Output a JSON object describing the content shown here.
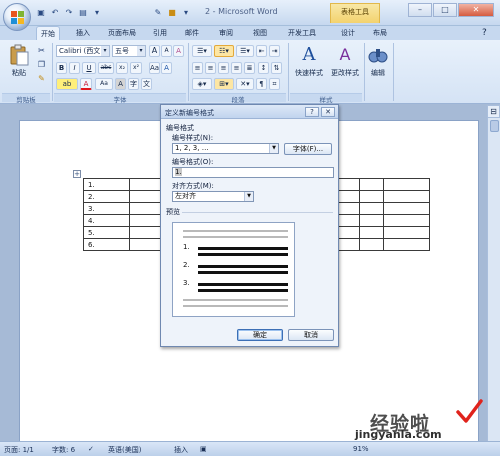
{
  "window": {
    "title": "2 - Microsoft Word",
    "contextual_tab_group": "表格工具",
    "controls": {
      "minimize": "–",
      "maximize": "□",
      "close": "✕"
    }
  },
  "quick_access": [
    "save-icon",
    "undo-icon",
    "redo-icon",
    "print-preview-icon"
  ],
  "tabs": [
    "开始",
    "插入",
    "页面布局",
    "引用",
    "邮件",
    "审阅",
    "视图",
    "开发工具",
    "设计",
    "布局"
  ],
  "active_tab": "开始",
  "ribbon": {
    "clipboard": {
      "paste_label": "粘贴",
      "group_label": "剪贴板"
    },
    "font": {
      "font_name": "Calibri (西文1",
      "font_size": "五号",
      "bold": "B",
      "italic": "I",
      "underline": "U",
      "strike": "abc",
      "subscript": "x₂",
      "superscript": "x²",
      "change_case": "Aa",
      "grow": "A",
      "shrink": "A",
      "clear": "A",
      "group_label": "字体"
    },
    "paragraph": {
      "group_label": "段落"
    },
    "styles": {
      "quick_styles_label": "快速样式",
      "change_styles_label": "更改样式",
      "group_label": "样式"
    },
    "editing": {
      "label": "编辑"
    }
  },
  "document": {
    "table_rows": [
      "1.",
      "2.",
      "3.",
      "4.",
      "5.",
      "6."
    ],
    "move_handle": "+"
  },
  "dialog": {
    "title": "定义新编号格式",
    "help": "?",
    "close": "✕",
    "section_label": "编号格式",
    "style_label": "编号样式(N):",
    "style_value": "1, 2, 3, …",
    "font_button": "字体(F)...",
    "format_label": "编号格式(O):",
    "format_value": "1.",
    "align_label": "对齐方式(M):",
    "align_value": "左对齐",
    "preview_label": "预览",
    "preview_numbers": [
      "1.",
      "2.",
      "3."
    ],
    "ok": "确定",
    "cancel": "取消"
  },
  "statusbar": {
    "page": "页面: 1/1",
    "words": "字数: 6",
    "language": "英语(美国)",
    "insert_mode": "插入",
    "zoom": "91%"
  },
  "watermark": {
    "text": "经验啦",
    "url": "jingyanla.com"
  }
}
